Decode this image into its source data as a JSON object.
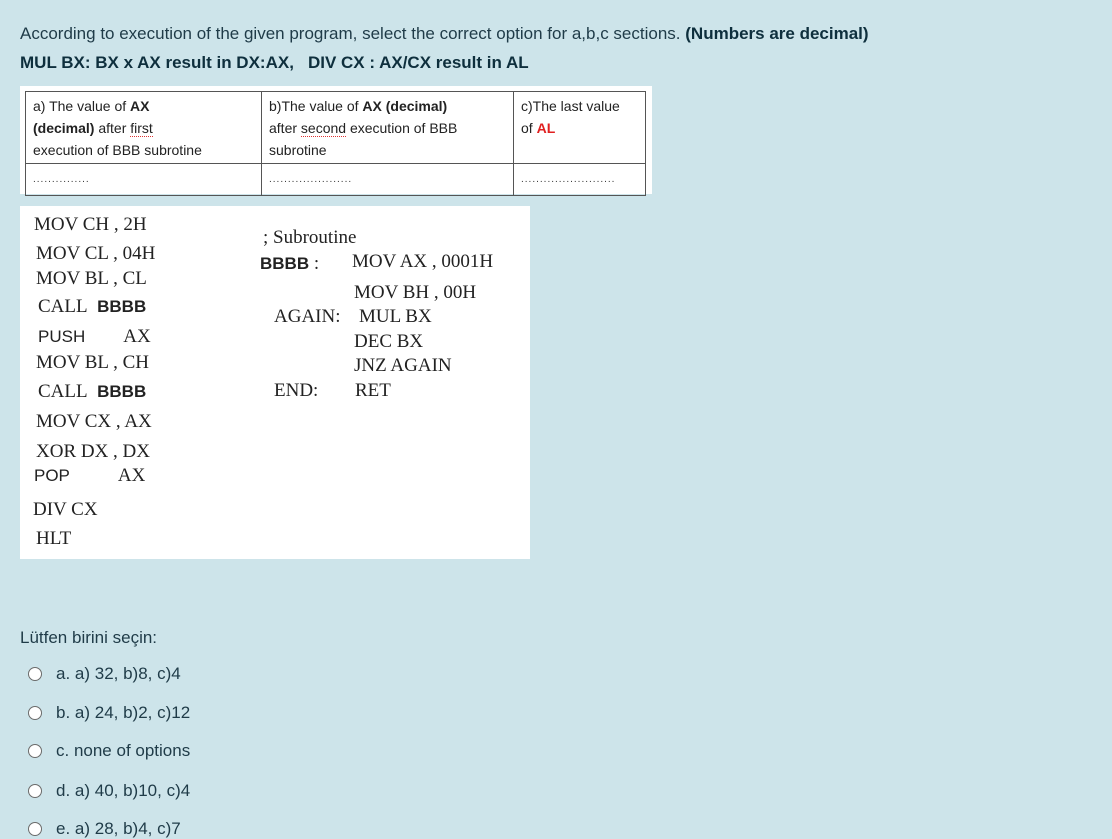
{
  "question": {
    "text": "According to execution of the given program, select the correct option for a,b,c sections.",
    "note": "(Numbers are decimal)",
    "mul_rule": "MUL BX: BX x AX result in DX:AX,",
    "div_rule": "DIV CX : AX/CX result in AL"
  },
  "table": {
    "a": {
      "pre": "a) The value of ",
      "ax": "AX",
      "decimal": "(decimal)",
      "after": " after ",
      "first": "first",
      "line3": "execution of BBB subrotine"
    },
    "b": {
      "pre": "b)The value of ",
      "ax": "AX (decimal)",
      "after": "after ",
      "second": "second",
      "rest": " execution of BBB",
      "line3": "subrotine"
    },
    "c": {
      "line1": "c)The last value",
      "of": "of ",
      "al": "AL"
    },
    "dots": [
      "...............",
      "......................",
      "........................."
    ]
  },
  "code": {
    "left": [
      "MOV CH ,  2H",
      "MOV CL , 04H",
      "MOV BL , CL",
      "CALL",
      "BBBB",
      "PUSH",
      "AX",
      "MOV BL , CH",
      "CALL",
      "BBBB",
      "MOV CX , AX",
      "XOR DX , DX",
      "POP",
      "AX",
      "DIV CX",
      "HLT"
    ],
    "right": {
      "comment": "; Subroutine",
      "label": "BBBB",
      "colon": ":",
      "l1": "MOV AX , 0001H",
      "l2": "MOV BH , 00H",
      "again_label": "AGAIN:",
      "l3": "MUL BX",
      "l4": "DEC BX",
      "l5": "JNZ AGAIN",
      "end_label": "END:",
      "l6": "RET"
    }
  },
  "prompt": "Lütfen birini seçin:",
  "options": [
    "a. a) 32, b)8, c)4",
    "b. a) 24, b)2, c)12",
    "c. none of options",
    "d. a) 40, b)10, c)4",
    "e. a) 28, b)4, c)7"
  ]
}
